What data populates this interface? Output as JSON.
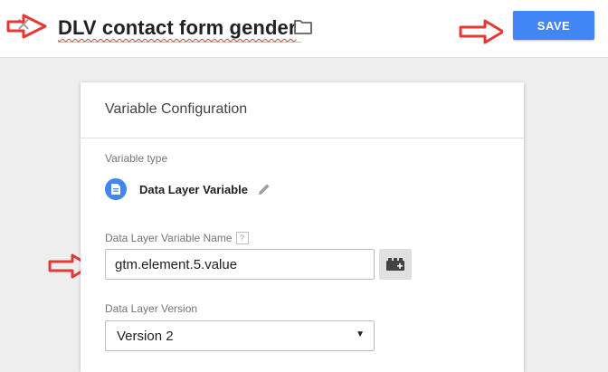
{
  "header": {
    "close_icon": "close-icon",
    "title": "DLV contact form gender",
    "folder_icon": "folder-icon",
    "save_label": "SAVE"
  },
  "card": {
    "title": "Variable Configuration",
    "variable_type_label": "Variable type",
    "variable_type_value": "Data Layer Variable",
    "dlv_name_label": "Data Layer Variable Name",
    "help_badge": "?",
    "dlv_name_value": "gtm.element.5.value",
    "version_label": "Data Layer Version",
    "version_value": "Version 2"
  },
  "colors": {
    "accent": "#4285f4",
    "annotation_arrow": "#e53935"
  }
}
